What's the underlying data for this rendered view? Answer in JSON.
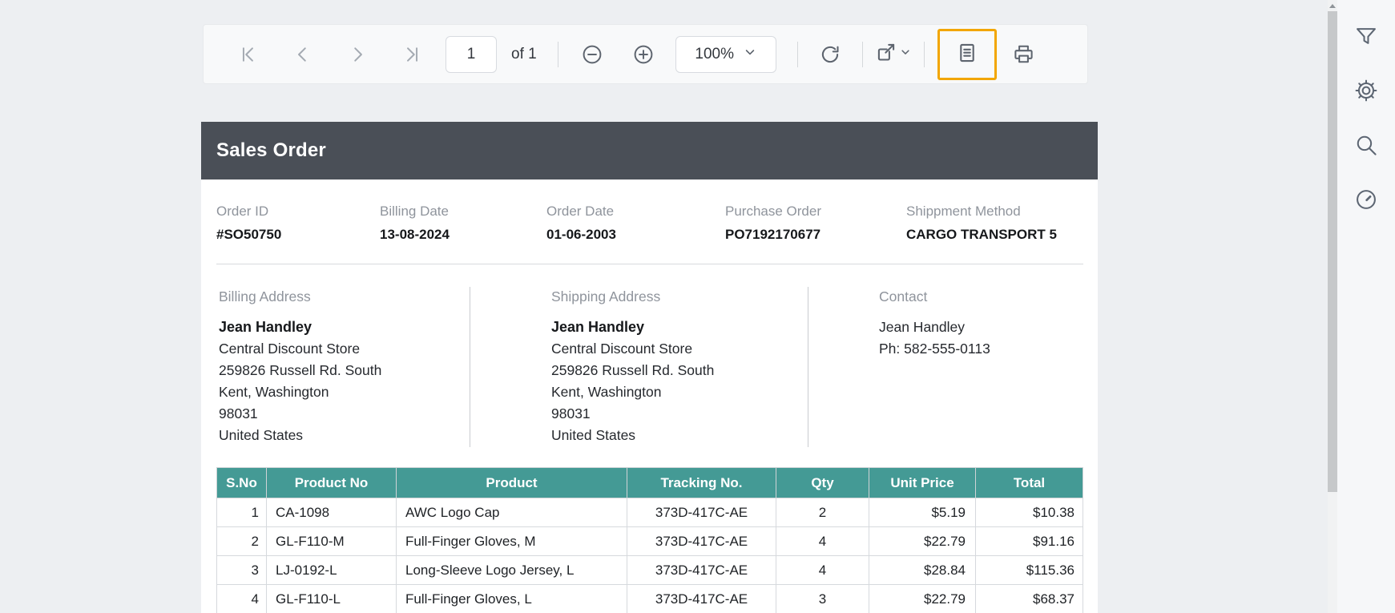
{
  "toolbar": {
    "page_value": "1",
    "of_label": "of 1",
    "zoom_value": "100%"
  },
  "colors": {
    "accent_orange": "#f2a600",
    "header_dark": "#4a4f57",
    "table_header_teal": "#449a95",
    "toolbar_bg": "#f8f9fa",
    "viewer_bg": "#edeff2"
  },
  "sidebar": {
    "icons": [
      "filter-icon",
      "settings-icon",
      "search-icon",
      "performance-icon"
    ]
  },
  "document": {
    "title": "Sales Order",
    "details": [
      {
        "label": "Order ID",
        "value": "#SO50750"
      },
      {
        "label": "Billing Date",
        "value": "13-08-2024"
      },
      {
        "label": "Order Date",
        "value": "01-06-2003"
      },
      {
        "label": "Purchase Order",
        "value": "PO7192170677"
      },
      {
        "label": "Shippment Method",
        "value": "CARGO TRANSPORT 5"
      }
    ],
    "billing": {
      "heading": "Billing Address",
      "name": "Jean Handley",
      "lines": [
        "Central Discount Store",
        "259826 Russell Rd. South",
        "Kent, Washington",
        "98031",
        "United States"
      ]
    },
    "shipping": {
      "heading": "Shipping Address",
      "name": "Jean Handley",
      "lines": [
        "Central Discount Store",
        "259826 Russell Rd. South",
        "Kent, Washington",
        "98031",
        "United States"
      ]
    },
    "contact": {
      "heading": "Contact",
      "name": "Jean Handley",
      "phone": "Ph: 582-555-0113"
    },
    "table": {
      "columns": [
        "S.No",
        "Product No",
        "Product",
        "Tracking No.",
        "Qty",
        "Unit Price",
        "Total"
      ],
      "rows": [
        [
          "1",
          "CA-1098",
          "AWC Logo Cap",
          "373D-417C-AE",
          "2",
          "$5.19",
          "$10.38"
        ],
        [
          "2",
          "GL-F110-M",
          "Full-Finger Gloves, M",
          "373D-417C-AE",
          "4",
          "$22.79",
          "$91.16"
        ],
        [
          "3",
          "LJ-0192-L",
          "Long-Sleeve Logo Jersey, L",
          "373D-417C-AE",
          "4",
          "$28.84",
          "$115.36"
        ],
        [
          "4",
          "GL-F110-L",
          "Full-Finger Gloves, L",
          "373D-417C-AE",
          "3",
          "$22.79",
          "$68.37"
        ]
      ]
    }
  }
}
